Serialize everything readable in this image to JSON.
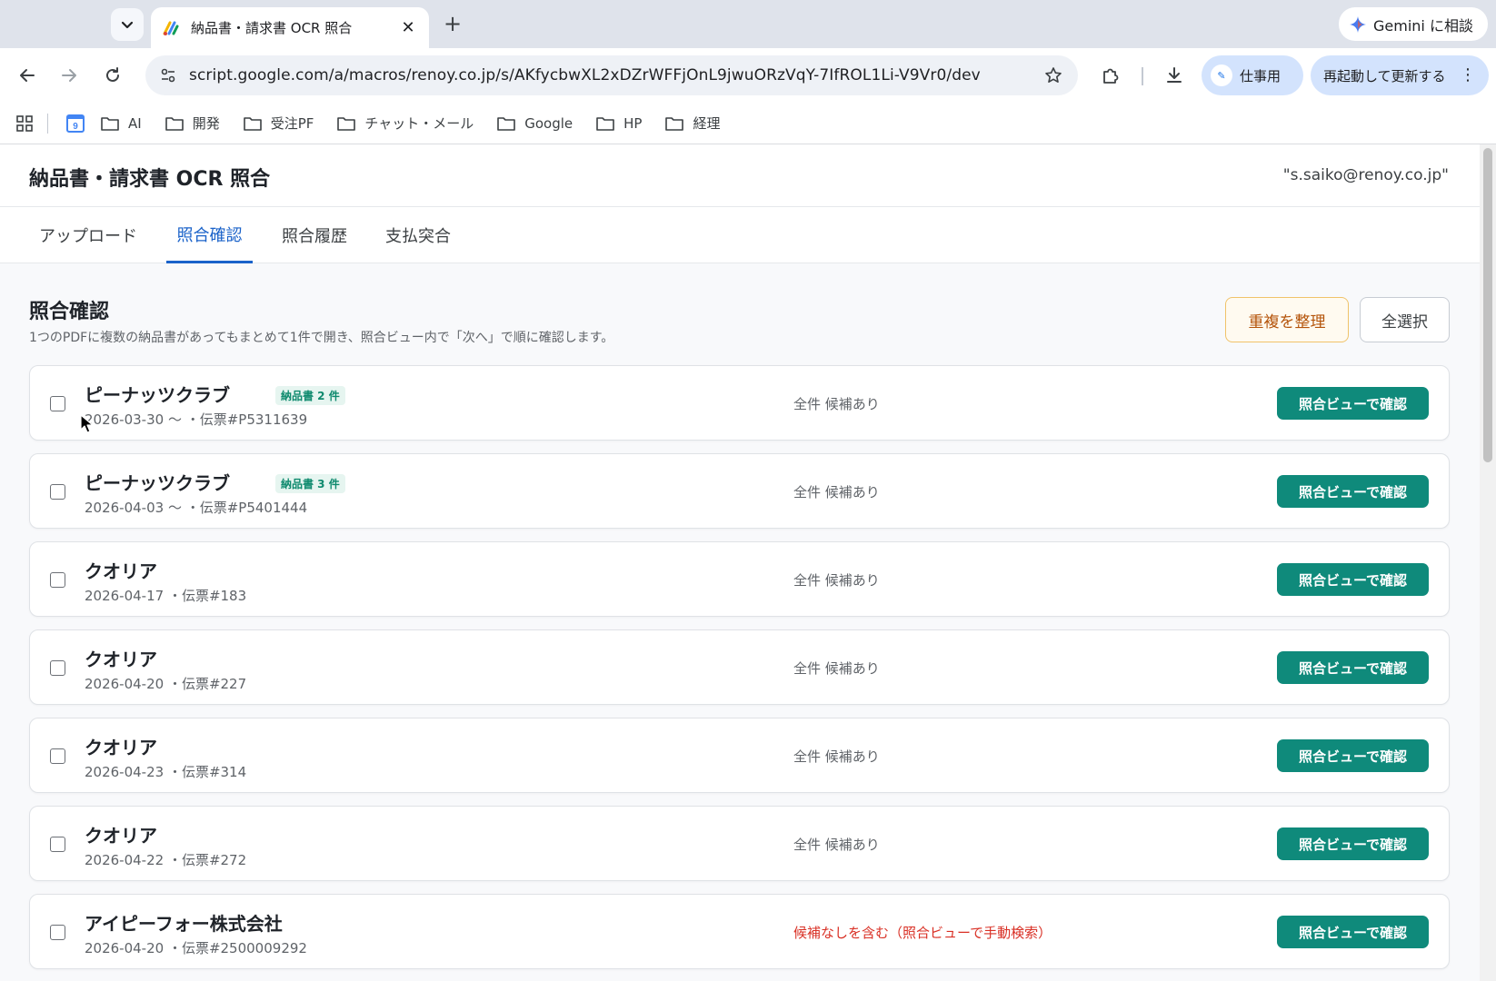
{
  "browser": {
    "tab_title": "納品書・請求書 OCR 照合",
    "url": "script.google.com/a/macros/renoy.co.jp/s/AKfycbwXL2xDZrWFFjOnL9jwuORzVqY-7IfROL1Li-V9Vr0/dev",
    "gemini_label": "Gemini に相談",
    "profile_label": "仕事用",
    "update_label": "再起動して更新する",
    "bookmarks": [
      "AI",
      "開発",
      "受注PF",
      "チャット・メール",
      "Google",
      "HP",
      "経理"
    ],
    "calendar_icon_text": "9"
  },
  "app": {
    "title": "納品書・請求書 OCR 照合",
    "user_email": "\"s.saiko@renoy.co.jp\"",
    "tabs": [
      {
        "label": "アップロード",
        "active": false
      },
      {
        "label": "照合確認",
        "active": true
      },
      {
        "label": "照合履歴",
        "active": false
      },
      {
        "label": "支払突合",
        "active": false
      }
    ]
  },
  "section": {
    "title": "照合確認",
    "description": "1つのPDFに複数の納品書があってもまとめて1件で開き、照合ビュー内で「次へ」で順に確認します。",
    "dedupe_label": "重複を整理",
    "select_all_label": "全選択"
  },
  "rows": [
    {
      "vendor": "ピーナッツクラブ",
      "badge": "納品書 2 件",
      "meta": "2026-03-30 〜 ・伝票#P5311639",
      "status": "全件 候補あり",
      "status_type": "ok",
      "action": "照合ビューで確認"
    },
    {
      "vendor": "ピーナッツクラブ",
      "badge": "納品書 3 件",
      "meta": "2026-04-03 〜 ・伝票#P5401444",
      "status": "全件 候補あり",
      "status_type": "ok",
      "action": "照合ビューで確認"
    },
    {
      "vendor": "クオリア",
      "badge": "",
      "meta": "2026-04-17 ・伝票#183",
      "status": "全件 候補あり",
      "status_type": "ok",
      "action": "照合ビューで確認"
    },
    {
      "vendor": "クオリア",
      "badge": "",
      "meta": "2026-04-20 ・伝票#227",
      "status": "全件 候補あり",
      "status_type": "ok",
      "action": "照合ビューで確認"
    },
    {
      "vendor": "クオリア",
      "badge": "",
      "meta": "2026-04-23 ・伝票#314",
      "status": "全件 候補あり",
      "status_type": "ok",
      "action": "照合ビューで確認"
    },
    {
      "vendor": "クオリア",
      "badge": "",
      "meta": "2026-04-22 ・伝票#272",
      "status": "全件 候補あり",
      "status_type": "ok",
      "action": "照合ビューで確認"
    },
    {
      "vendor": "アイピーフォー株式会社",
      "badge": "",
      "meta": "2026-04-20 ・伝票#2500009292",
      "status": "候補なしを含む（照合ビューで手動検索）",
      "status_type": "warn",
      "action": "照合ビューで確認"
    }
  ],
  "colors": {
    "accent_blue": "#1a62c9",
    "action_teal": "#0f8a7b",
    "badge_green": "#0f8a6e",
    "warn_red": "#d93025",
    "dedupe_orange": "#b45309"
  }
}
